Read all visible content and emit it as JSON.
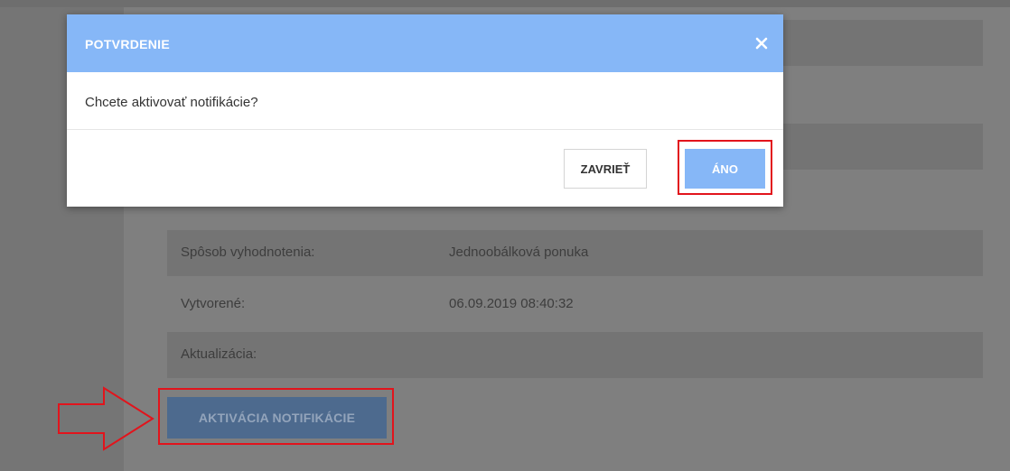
{
  "modal": {
    "title": "POTVRDENIE",
    "message": "Chcete aktivovať notifikácie?",
    "close_label": "ZAVRIEŤ",
    "confirm_label": "ÁNO",
    "close_icon": "close-icon"
  },
  "details": [
    {
      "label": "Spôsob vyhodnotenia:",
      "value": "Jednoobálková ponuka"
    },
    {
      "label": "Vytvorené:",
      "value": "06.09.2019 08:40:32"
    },
    {
      "label": "Aktualizácia:",
      "value": ""
    }
  ],
  "actions": {
    "activate_label": "AKTIVÁCIA NOTIFIKÁCIE"
  },
  "colors": {
    "accent": "#86b7f7",
    "highlight": "#e2141c",
    "overlay": "#7f7f7f"
  }
}
